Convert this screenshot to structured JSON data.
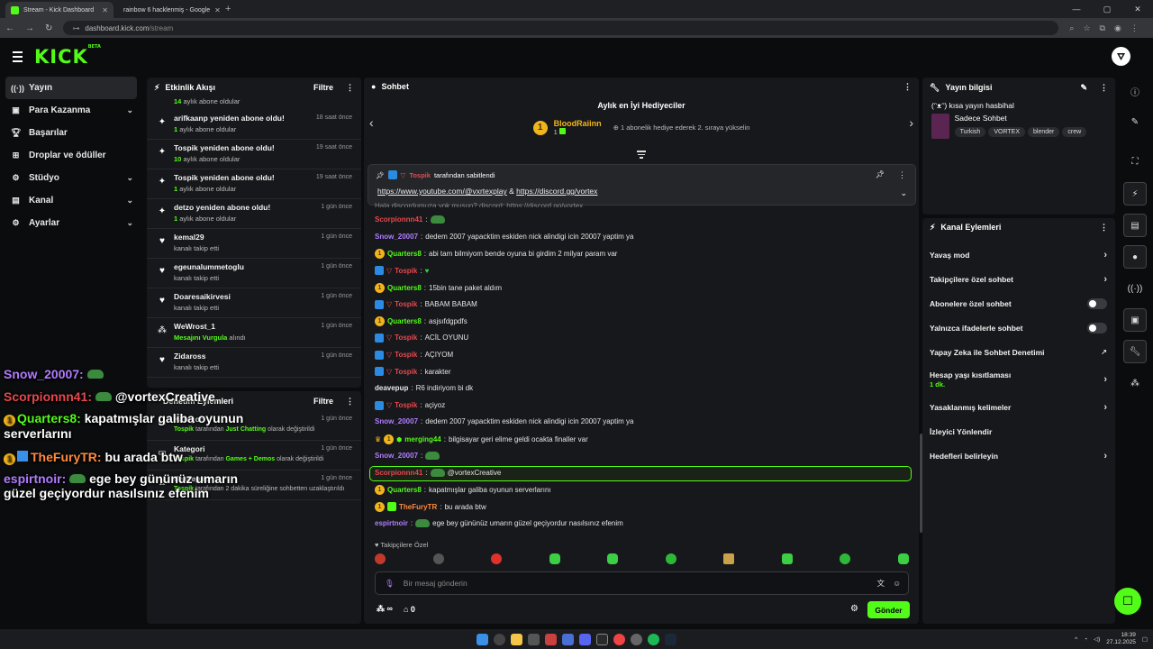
{
  "browser": {
    "tabs": [
      {
        "title": "Stream - Kick Dashboard",
        "active": true
      },
      {
        "title": "rainbow 6 hacklenmiş - Google",
        "active": false
      }
    ],
    "url_host": "dashboard.kick.com",
    "url_path": "/stream"
  },
  "brand": {
    "logo": "KICK",
    "beta": "BETA",
    "accent": "#53fc18"
  },
  "sidebar": {
    "items": [
      {
        "label": "Yayın",
        "icon": "broadcast-icon",
        "active": true
      },
      {
        "label": "Para Kazanma",
        "icon": "money-icon",
        "expandable": true
      },
      {
        "label": "Başarılar",
        "icon": "trophy-icon"
      },
      {
        "label": "Droplar ve ödüller",
        "icon": "gift-icon"
      },
      {
        "label": "Stüdyo",
        "icon": "gear-icon",
        "expandable": true
      },
      {
        "label": "Kanal",
        "icon": "channel-icon",
        "expandable": true
      },
      {
        "label": "Ayarlar",
        "icon": "settings-icon",
        "expandable": true
      }
    ]
  },
  "activity": {
    "title": "Etkinlik Akışı",
    "filter": "Filtre",
    "top_partial": {
      "count": "14",
      "text": "aylık abone oldular"
    },
    "items": [
      {
        "title": "arifkaanp yeniden abone oldu!",
        "count": "1",
        "sub": "aylık abone oldular",
        "time": "18 saat önce",
        "icon": "sparkle-icon"
      },
      {
        "title": "Tospik yeniden abone oldu!",
        "count": "10",
        "sub": "aylık abone oldular",
        "time": "19 saat önce",
        "icon": "sparkle-icon"
      },
      {
        "title": "Tospik yeniden abone oldu!",
        "count": "1",
        "sub": "aylık abone oldular",
        "time": "19 saat önce",
        "icon": "sparkle-icon"
      },
      {
        "title": "detzo yeniden abone oldu!",
        "count": "1",
        "sub": "aylık abone oldular",
        "time": "1 gün önce",
        "icon": "sparkle-icon"
      },
      {
        "title": "kemal29",
        "count": "",
        "sub": "kanalı takip etti",
        "time": "1 gün önce",
        "icon": "heart-icon"
      },
      {
        "title": "egeunalummetoglu",
        "count": "",
        "sub": "kanalı takip etti",
        "time": "1 gün önce",
        "icon": "heart-icon"
      },
      {
        "title": "Doaresaikirvesi",
        "count": "",
        "sub": "kanalı takip etti",
        "time": "1 gün önce",
        "icon": "heart-icon"
      },
      {
        "title": "WeWrost_1",
        "count": "Mesajını Vurgula",
        "sub": "alındı",
        "time": "1 gün önce",
        "icon": "dots-icon"
      },
      {
        "title": "Zidaross",
        "count": "",
        "sub": "kanalı takip etti",
        "time": "1 gün önce",
        "icon": "heart-icon"
      }
    ]
  },
  "moderation": {
    "title": "Denetim Eylemleri",
    "filter": "Filtre",
    "items": [
      {
        "title": "Kategori",
        "user": "Tospik",
        "mid": "tarafından",
        "value": "Just Chatting",
        "tail": "olarak değiştirildi",
        "time": "1 gün önce"
      },
      {
        "title": "Kategori",
        "user": "Tospik",
        "mid": "tarafından",
        "value": "Games + Demos",
        "tail": "olarak değiştirildi",
        "time": "1 gün önce"
      },
      {
        "title": "deavepup",
        "user": "Tospik",
        "mid": "tarafından 2 dakika süreliğine sohbetten",
        "value": "",
        "tail": "uzaklaştırıldı",
        "time": "1 gün önce"
      }
    ]
  },
  "chat": {
    "title": "Sohbet",
    "gifters_title": "Aylık en İyi Hediyeciler",
    "top_gifter": "BloodRaiinn",
    "top_gifter_count": "1",
    "gifter_hint": "1 abonelik hediye ederek 2. sıraya yükselin",
    "pinned_by": "Tospik",
    "pinned_label": "tarafından sabitlendi",
    "pinned_link1": "https://www.youtube.com/@vxrtexplay",
    "pinned_amp": "&",
    "pinned_link2": "https://discord.gg/vortex",
    "partial_top": "Hala discordumuza yok musun?   discord: https://discord.gg/vortex",
    "messages": [
      {
        "user": "Scorpionnn41",
        "color": "#e5484d",
        "text": "",
        "emote": true,
        "badges": []
      },
      {
        "user": "Snow_20007",
        "color": "#b07cff",
        "text": "dedem 2007 yapacktim eskiden nick alindigi icin 20007 yaptim ya",
        "badges": []
      },
      {
        "user": "Quarters8",
        "color": "#53fc18",
        "text": "abi tam bilmiyom bende oyuna bi girdim 2 milyar param var",
        "badges": [
          "sub"
        ]
      },
      {
        "user": "Tospik",
        "color": "#e5484d",
        "text": "",
        "heart": true,
        "badges": [
          "mod",
          "vip"
        ]
      },
      {
        "user": "Quarters8",
        "color": "#53fc18",
        "text": "15bin tane paket aldım",
        "badges": [
          "sub"
        ]
      },
      {
        "user": "Tospik",
        "color": "#e5484d",
        "text": "BABAM BABAM",
        "badges": [
          "mod",
          "vip"
        ]
      },
      {
        "user": "Quarters8",
        "color": "#53fc18",
        "text": "asjsıfdgpdfs",
        "badges": [
          "sub"
        ]
      },
      {
        "user": "Tospik",
        "color": "#e5484d",
        "text": "ACİL OYUNU",
        "badges": [
          "mod",
          "vip"
        ]
      },
      {
        "user": "Tospik",
        "color": "#e5484d",
        "text": "AÇIYOM",
        "badges": [
          "mod",
          "vip"
        ]
      },
      {
        "user": "Tospik",
        "color": "#e5484d",
        "text": "karakter",
        "badges": [
          "mod",
          "vip"
        ]
      },
      {
        "user": "deavepup",
        "color": "#e8e8e8",
        "text": "R6 indiriyom bi dk",
        "badges": []
      },
      {
        "user": "Tospik",
        "color": "#e5484d",
        "text": "açiyoz",
        "badges": [
          "mod",
          "vip"
        ]
      },
      {
        "user": "Snow_20007",
        "color": "#b07cff",
        "text": "dedem 2007 yapacktim eskiden nick alindigi icin 20007 yaptim ya",
        "badges": []
      },
      {
        "user": "merging44",
        "color": "#53fc18",
        "text": "bilgisayar geri elime geldi ocakta finaller var",
        "badges": [
          "crown",
          "sub",
          "og"
        ]
      },
      {
        "user": "Snow_20007",
        "color": "#b07cff",
        "text": "",
        "emote": true,
        "badges": []
      },
      {
        "user": "Scorpionnn41",
        "color": "#e5484d",
        "text": "@vortexCreative",
        "emote": true,
        "highlight": true,
        "badges": []
      },
      {
        "user": "Quarters8",
        "color": "#53fc18",
        "text": "kapatmışlar galiba oyunun serverlarını",
        "badges": [
          "sub"
        ]
      },
      {
        "user": "TheFuryTR",
        "color": "#ff8a3d",
        "text": "bu arada btw",
        "badges": [
          "sub",
          "gift"
        ]
      },
      {
        "user": "espirtnoir",
        "color": "#b07cff",
        "text": "ege bey gününüz umarın güzel geçiyordur nasılsınız efenim",
        "emote": true,
        "badges": []
      }
    ],
    "followers_only": "Takipçilere Özel",
    "placeholder": "Bir mesaj gönderin",
    "points": "0",
    "infinity": "∞",
    "send": "Gönder"
  },
  "stream_info": {
    "title": "Yayın bilgisi",
    "stream_title": "(ᵔᴥᵔ) kısa yayın hasbihal",
    "category": "Sadece Sohbet",
    "tags": [
      "Turkish",
      "VORTEX",
      "blender",
      "crew"
    ]
  },
  "channel_actions": {
    "title": "Kanal Eylemleri",
    "items": [
      {
        "label": "Yavaş mod",
        "type": "chevron"
      },
      {
        "label": "Takipçilere özel sohbet",
        "type": "chevron"
      },
      {
        "label": "Abonelere özel sohbet",
        "type": "toggle"
      },
      {
        "label": "Yalnızca ifadelerle sohbet",
        "type": "toggle"
      },
      {
        "label": "Yapay Zeka ile Sohbet Denetimi",
        "type": "external"
      },
      {
        "label": "Hesap yaşı kısıtlaması",
        "sub": "1 dk.",
        "type": "chevron"
      },
      {
        "label": "Yasaklanmış kelimeler",
        "type": "chevron"
      },
      {
        "label": "İzleyici Yönlendir",
        "type": "none"
      },
      {
        "label": "Hedefleri belirleyin",
        "type": "chevron"
      }
    ]
  },
  "overlay": [
    {
      "user": "Snow_20007:",
      "color": "#b07cff",
      "text": "",
      "emote": true
    },
    {
      "user": "Scorpionnn41:",
      "color": "#e5484d",
      "text": "@vortexCreative",
      "emote": true
    },
    {
      "user": "Quarters8:",
      "color": "#53fc18",
      "text": "kapatmışlar galiba oyunun",
      "text2": "serverlarını",
      "badge": true
    },
    {
      "user": "TheFuryTR:",
      "color": "#ff8a3d",
      "text": "bu arada btw",
      "badge": true
    },
    {
      "user": "espirtnoir:",
      "color": "#b07cff",
      "text": "ege bey gününüz umarın",
      "text2": "güzel geçiyordur nasılsınız efenim",
      "emote": true
    }
  ],
  "taskbar": {
    "time": "18:39",
    "date": "27.12.2025"
  }
}
